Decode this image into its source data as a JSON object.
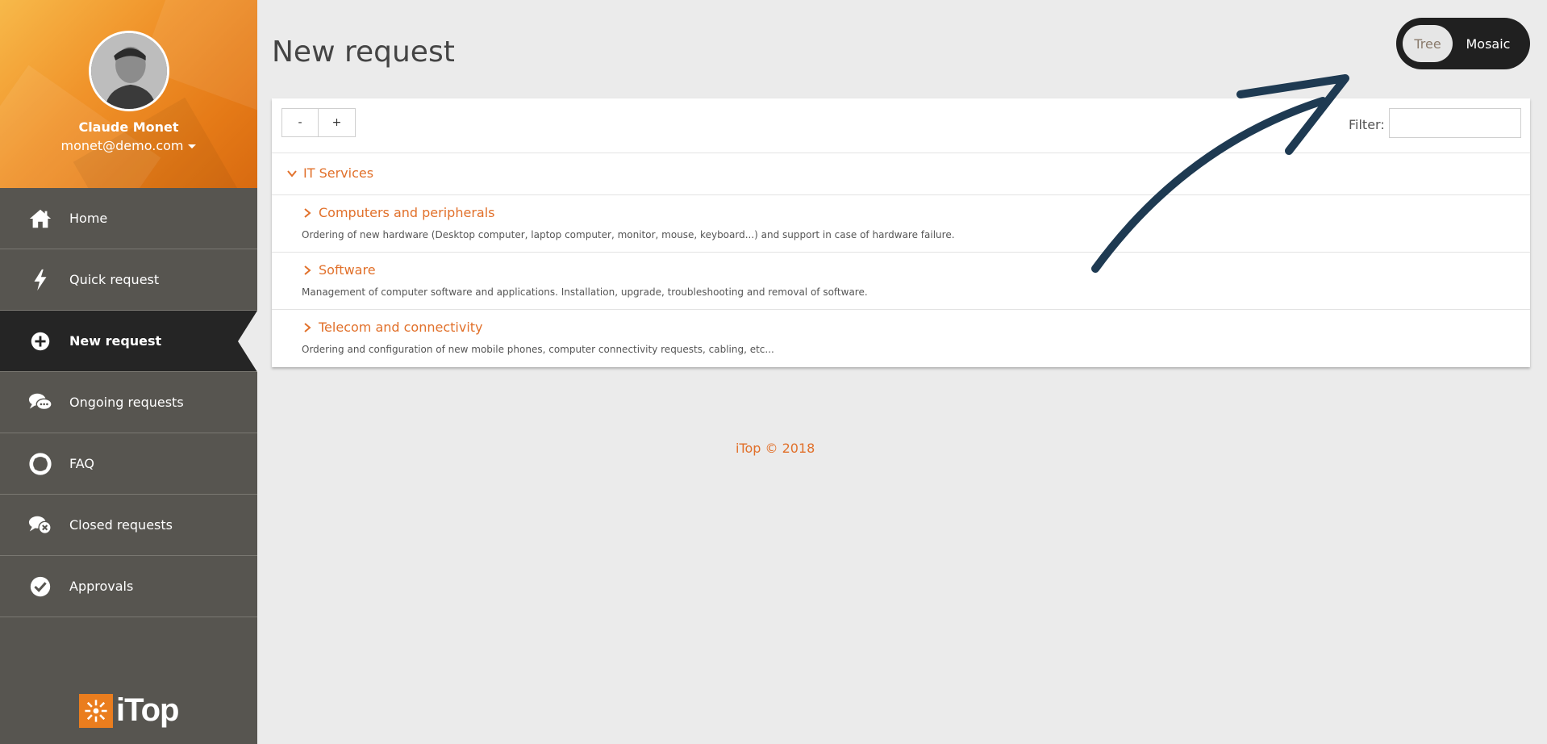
{
  "user": {
    "name": "Claude Monet",
    "email": "monet@demo.com"
  },
  "sidebar": {
    "items": [
      {
        "label": "Home",
        "icon": "home-icon"
      },
      {
        "label": "Quick request",
        "icon": "bolt-icon"
      },
      {
        "label": "New request",
        "icon": "plus-circle-icon",
        "active": true
      },
      {
        "label": "Ongoing requests",
        "icon": "chat-bubbles-icon"
      },
      {
        "label": "FAQ",
        "icon": "lifebuoy-icon"
      },
      {
        "label": "Closed requests",
        "icon": "chat-closed-icon"
      },
      {
        "label": "Approvals",
        "icon": "check-circle-icon"
      }
    ],
    "brand": "iTop"
  },
  "page": {
    "title": "New request"
  },
  "view_switch": {
    "tree": "Tree",
    "mosaic": "Mosaic"
  },
  "toolbar": {
    "collapse_label": "-",
    "expand_label": "+",
    "filter_label": "Filter:",
    "filter_value": ""
  },
  "tree": {
    "root": "IT Services",
    "children": [
      {
        "label": "Computers and peripherals",
        "desc": "Ordering of new hardware (Desktop computer, laptop computer, monitor, mouse, keyboard...) and support in case of hardware failure."
      },
      {
        "label": "Software",
        "desc": "Management of computer software and applications. Installation, upgrade, troubleshooting and removal of software."
      },
      {
        "label": "Telecom and connectivity",
        "desc": "Ordering and configuration of new mobile phones, computer connectivity requests, cabling, etc..."
      }
    ]
  },
  "footer": {
    "text": "iTop © 2018"
  },
  "colors": {
    "accent": "#e1702a",
    "sidebar": "#575550",
    "sidebar_active": "#252525",
    "arrow": "#1e3a52"
  }
}
